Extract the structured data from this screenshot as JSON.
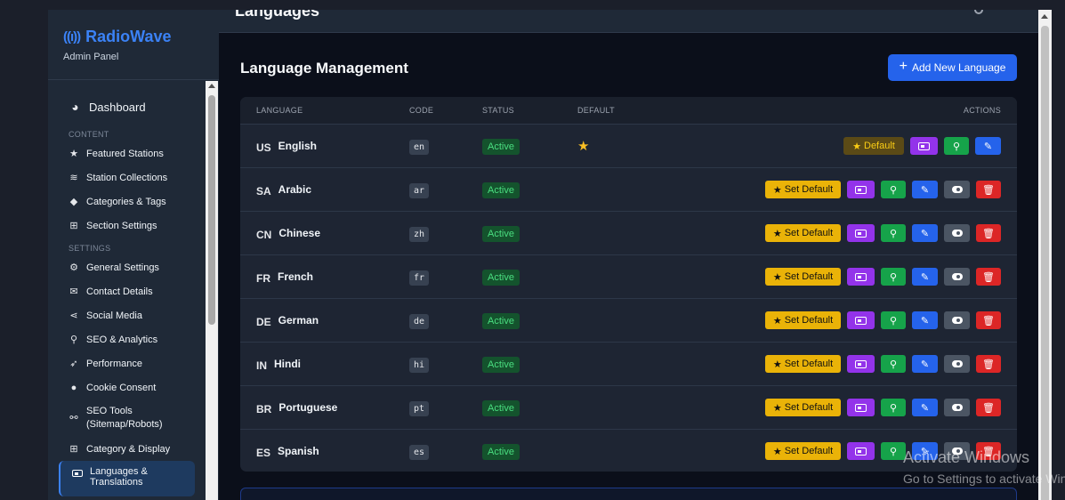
{
  "brand": {
    "title": "RadioWave",
    "subtitle": "Admin Panel",
    "icon": "radio-tower-icon"
  },
  "sidebar": {
    "dashboard": {
      "label": "Dashboard",
      "icon": "palette-icon"
    },
    "content_heading": "CONTENT",
    "content_items": [
      {
        "label": "Featured Stations",
        "icon": "star-icon"
      },
      {
        "label": "Station Collections",
        "icon": "layers-icon"
      },
      {
        "label": "Categories & Tags",
        "icon": "tags-icon"
      },
      {
        "label": "Section Settings",
        "icon": "grid-icon"
      }
    ],
    "settings_heading": "SETTINGS",
    "settings_items": [
      {
        "label": "General Settings",
        "icon": "gear-icon"
      },
      {
        "label": "Contact Details",
        "icon": "envelope-icon"
      },
      {
        "label": "Social Media",
        "icon": "share-icon"
      },
      {
        "label": "SEO & Analytics",
        "icon": "search-icon"
      },
      {
        "label": "Performance",
        "icon": "rocket-icon"
      },
      {
        "label": "Cookie Consent",
        "icon": "cookie-icon"
      },
      {
        "label": "SEO Tools",
        "label2": "(Sitemap/Robots)",
        "icon": "sitemap-icon"
      },
      {
        "label": "Category & Display",
        "icon": "table-icon"
      },
      {
        "label": "Languages &",
        "label2": "Translations",
        "icon": "language-icon",
        "active": true
      }
    ]
  },
  "topbar": {
    "title": "Languages"
  },
  "main": {
    "title": "Language Management",
    "add_button": "Add New Language",
    "columns": {
      "language": "LANGUAGE",
      "code": "CODE",
      "status": "STATUS",
      "default": "DEFAULT",
      "actions": "ACTIONS"
    },
    "actions": {
      "set_default": "Set Default",
      "default": "Default"
    },
    "languages": [
      {
        "flag": "US",
        "name": "English",
        "code": "en",
        "status": "Active",
        "is_default": true
      },
      {
        "flag": "SA",
        "name": "Arabic",
        "code": "ar",
        "status": "Active",
        "is_default": false
      },
      {
        "flag": "CN",
        "name": "Chinese",
        "code": "zh",
        "status": "Active",
        "is_default": false
      },
      {
        "flag": "FR",
        "name": "French",
        "code": "fr",
        "status": "Active",
        "is_default": false
      },
      {
        "flag": "DE",
        "name": "German",
        "code": "de",
        "status": "Active",
        "is_default": false
      },
      {
        "flag": "IN",
        "name": "Hindi",
        "code": "hi",
        "status": "Active",
        "is_default": false
      },
      {
        "flag": "BR",
        "name": "Portuguese",
        "code": "pt",
        "status": "Active",
        "is_default": false
      },
      {
        "flag": "ES",
        "name": "Spanish",
        "code": "es",
        "status": "Active",
        "is_default": false
      }
    ]
  },
  "watermark": {
    "line1": "Activate Windows",
    "line2": "Go to Settings to activate Windows."
  },
  "colors": {
    "accent": "#3b82f6",
    "set_default": "#eab308",
    "translate": "#9333ea",
    "seo": "#16a34a",
    "edit": "#2563eb",
    "toggle": "#4b5563",
    "delete": "#dc2626",
    "active_badge": "#4ade80"
  }
}
